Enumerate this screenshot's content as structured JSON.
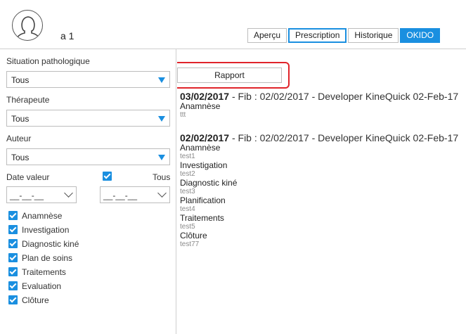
{
  "header": {
    "patient_name": "a 1",
    "tabs": [
      {
        "label": "Aperçu",
        "state": "normal"
      },
      {
        "label": "Prescription",
        "state": "active"
      },
      {
        "label": "Historique",
        "state": "normal"
      },
      {
        "label": "OKIDO",
        "state": "primary"
      }
    ]
  },
  "sidebar": {
    "situation": {
      "label": "Situation pathologique",
      "value": "Tous"
    },
    "therapeute": {
      "label": "Thérapeute",
      "value": "Tous"
    },
    "auteur": {
      "label": "Auteur",
      "value": "Tous"
    },
    "date_valeur": {
      "label": "Date valeur",
      "tous_label": "Tous",
      "from": "__-__-__",
      "to": "__-__-__"
    },
    "filters": [
      {
        "label": "Anamnèse",
        "checked": true
      },
      {
        "label": "Investigation",
        "checked": true
      },
      {
        "label": "Diagnostic kiné",
        "checked": true
      },
      {
        "label": "Plan de soins",
        "checked": true
      },
      {
        "label": "Traitements",
        "checked": true
      },
      {
        "label": "Evaluation",
        "checked": true
      },
      {
        "label": "Clôture",
        "checked": true
      }
    ]
  },
  "main": {
    "rapport_label": "Rapport",
    "entries": [
      {
        "date": "03/02/2017",
        "rest": " - Fib : 02/02/2017 - Developer KineQuick 02-Feb-17",
        "sections": [
          {
            "title": "Anamnèse",
            "note": "ttt"
          }
        ]
      },
      {
        "date": "02/02/2017",
        "rest": " - Fib : 02/02/2017 - Developer KineQuick 02-Feb-17",
        "sections": [
          {
            "title": "Anamnèse",
            "note": "test1"
          },
          {
            "title": "Investigation",
            "note": "test2"
          },
          {
            "title": "Diagnostic kiné",
            "note": "test3"
          },
          {
            "title": "Planification",
            "note": "test4"
          },
          {
            "title": "Traitements",
            "note": "test5"
          },
          {
            "title": "Clôture",
            "note": "test77"
          }
        ]
      }
    ]
  },
  "colors": {
    "accent": "#1a8fe0",
    "highlight": "#e0242a"
  }
}
